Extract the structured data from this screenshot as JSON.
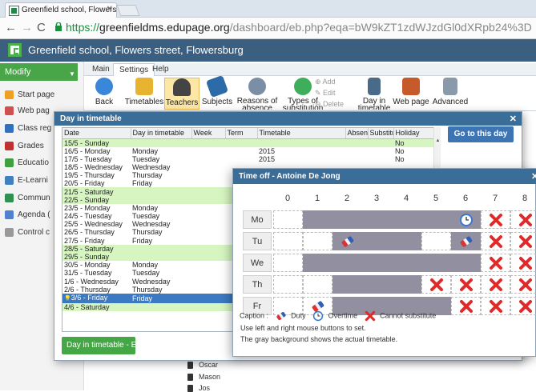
{
  "browser": {
    "tab_title": "Greenfield school, Flowers",
    "url_scheme": "https://",
    "url_host": "greenfieldms.edupage.org",
    "url_rest": "/dashboard/eb.php?eqa=bW9kZT1zdWJzdGl0dXRpb24%3D"
  },
  "app": {
    "title": "Greenfield school, Flowers street, Flowersburg"
  },
  "sidebar": {
    "modify_label": "Modify",
    "items": [
      {
        "label": "Start page",
        "color": "#f0a020"
      },
      {
        "label": "Web pag",
        "color": "#d05050"
      },
      {
        "label": "Class reg",
        "color": "#3070c0"
      },
      {
        "label": "Grades",
        "color": "#c03030"
      },
      {
        "label": "Educatio",
        "color": "#40a040"
      },
      {
        "label": "E-Learni",
        "color": "#4080c0"
      },
      {
        "label": "Commun",
        "color": "#309050"
      },
      {
        "label": "Agenda (",
        "color": "#5080d0"
      },
      {
        "label": "Control c",
        "color": "#999999"
      }
    ]
  },
  "ribbon": {
    "tabs": [
      "Main",
      "Settings",
      "Help"
    ],
    "buttons": [
      {
        "label": "Back"
      },
      {
        "label": "Timetables"
      },
      {
        "label": "Teachers"
      },
      {
        "label": "Subjects"
      },
      {
        "label": "Reasons of absence"
      },
      {
        "label": "Types of substitution"
      },
      {
        "label": "Add"
      },
      {
        "label": "Edit"
      },
      {
        "label": "Delete"
      },
      {
        "label": "Day in timetable"
      },
      {
        "label": "Web page"
      },
      {
        "label": "Advanced"
      }
    ]
  },
  "day_dialog": {
    "title": "Day in timetable",
    "columns": [
      "Date",
      "Day in timetable",
      "Week",
      "Term",
      "Timetable",
      "Absent",
      "Substitu",
      "Holiday"
    ],
    "rows": [
      {
        "date": "15/5 - Sunday",
        "day": "",
        "timetable": "",
        "holiday": "No",
        "kind": "weekend"
      },
      {
        "date": "16/5 - Monday",
        "day": "Monday",
        "timetable": "2015",
        "holiday": "No",
        "kind": ""
      },
      {
        "date": "17/5 - Tuesday",
        "day": "Tuesday",
        "timetable": "2015",
        "holiday": "No",
        "kind": ""
      },
      {
        "date": "18/5 - Wednesday",
        "day": "Wednesday",
        "timetable": "",
        "holiday": "",
        "kind": ""
      },
      {
        "date": "19/5 - Thursday",
        "day": "Thursday",
        "timetable": "",
        "holiday": "",
        "kind": ""
      },
      {
        "date": "20/5 - Friday",
        "day": "Friday",
        "timetable": "",
        "holiday": "",
        "kind": ""
      },
      {
        "date": "21/5 - Saturday",
        "day": "",
        "timetable": "",
        "holiday": "",
        "kind": "weekend"
      },
      {
        "date": "22/5 - Sunday",
        "day": "",
        "timetable": "",
        "holiday": "",
        "kind": "weekend"
      },
      {
        "date": "23/5 - Monday",
        "day": "Monday",
        "timetable": "",
        "holiday": "",
        "kind": ""
      },
      {
        "date": "24/5 - Tuesday",
        "day": "Tuesday",
        "timetable": "",
        "holiday": "",
        "kind": ""
      },
      {
        "date": "25/5 - Wednesday",
        "day": "Wednesday",
        "timetable": "",
        "holiday": "",
        "kind": ""
      },
      {
        "date": "26/5 - Thursday",
        "day": "Thursday",
        "timetable": "",
        "holiday": "",
        "kind": ""
      },
      {
        "date": "27/5 - Friday",
        "day": "Friday",
        "timetable": "",
        "holiday": "",
        "kind": ""
      },
      {
        "date": "28/5 - Saturday",
        "day": "",
        "timetable": "",
        "holiday": "",
        "kind": "weekend"
      },
      {
        "date": "29/5 - Sunday",
        "day": "",
        "timetable": "",
        "holiday": "",
        "kind": "weekend"
      },
      {
        "date": "30/5 - Monday",
        "day": "Monday",
        "timetable": "",
        "holiday": "",
        "kind": ""
      },
      {
        "date": "31/5 - Tuesday",
        "day": "Tuesday",
        "timetable": "",
        "holiday": "",
        "kind": ""
      },
      {
        "date": "1/6 - Wednesday",
        "day": "Wednesday",
        "timetable": "",
        "holiday": "",
        "kind": ""
      },
      {
        "date": "2/6 - Thursday",
        "day": "Thursday",
        "timetable": "",
        "holiday": "",
        "kind": ""
      },
      {
        "date": "3/6 - Friday",
        "day": "Friday",
        "timetable": "",
        "holiday": "",
        "kind": "selected"
      },
      {
        "date": "4/6 - Saturday",
        "day": "",
        "timetable": "",
        "holiday": "",
        "kind": "weekend"
      }
    ],
    "goto_label": "Go to this day",
    "edit_label": "Day in timetable - Edit"
  },
  "background_list": [
    "Oscar",
    "Mason",
    "Jos"
  ],
  "timeoff_dialog": {
    "title": "Time off - Antoine De Jong",
    "periods": [
      "0",
      "1",
      "2",
      "3",
      "4",
      "5",
      "6",
      "7",
      "8"
    ],
    "days": [
      {
        "label": "Mo",
        "cells": [
          "",
          "g",
          "g",
          "g",
          "g",
          "g",
          "go",
          "x",
          "x"
        ]
      },
      {
        "label": "Tu",
        "cells": [
          "",
          "",
          "gd",
          "g",
          "g",
          "",
          "gd",
          "x",
          "x"
        ]
      },
      {
        "label": "We",
        "cells": [
          "",
          "g",
          "g",
          "g",
          "g",
          "g",
          "g",
          "x",
          "x"
        ]
      },
      {
        "label": "Th",
        "cells": [
          "",
          "",
          "g",
          "g",
          "g",
          "x",
          "x",
          "x",
          "x"
        ]
      },
      {
        "label": "Fr",
        "cells": [
          "",
          "d",
          "g",
          "g",
          "g",
          "g",
          "x",
          "x",
          "x"
        ]
      }
    ],
    "caption_label": "Caption :",
    "legend": {
      "duty": "Duty",
      "overtime": "Overtime",
      "cannot": "Cannot substitute"
    },
    "help_line1": "Use left and right mouse buttons to set.",
    "help_line2": "The gray background shows the actual timetable."
  }
}
